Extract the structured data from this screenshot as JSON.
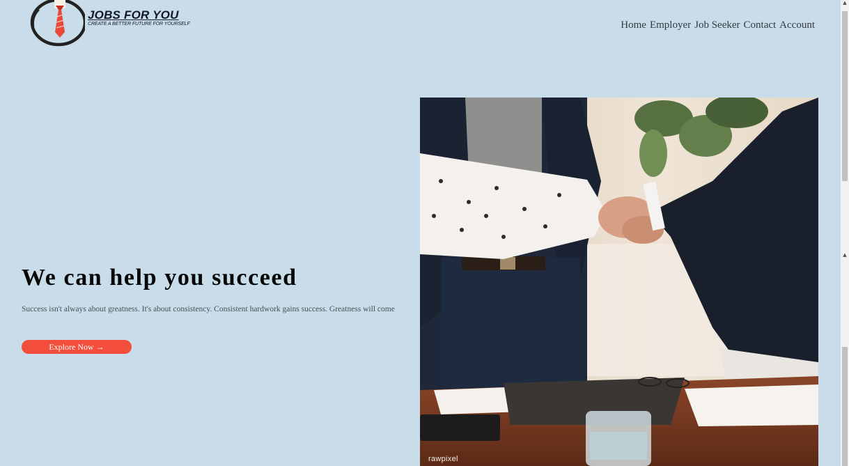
{
  "brand": {
    "title": "JOBS FOR YOU",
    "tagline": "CREATE A BETTER FUTURE FOR YOURSELF",
    "colors": {
      "tie": "#e8493a",
      "ring": "#2a2a2a"
    }
  },
  "nav": {
    "items": [
      "Home",
      "Employer",
      "Job Seeker",
      "Contact",
      "Account"
    ]
  },
  "hero": {
    "title": "We can help you succeed",
    "subtitle": "Success isn't always about greatness. It's about consistency. Consistent hardwork gains success. Greatness will come",
    "cta_label": "Explore Now →",
    "accent_color": "#f24e3b"
  },
  "image": {
    "watermark": "rawpixel"
  },
  "colors": {
    "background": "#c8dde9",
    "heading": "#070707",
    "nav_text": "#333a44"
  }
}
